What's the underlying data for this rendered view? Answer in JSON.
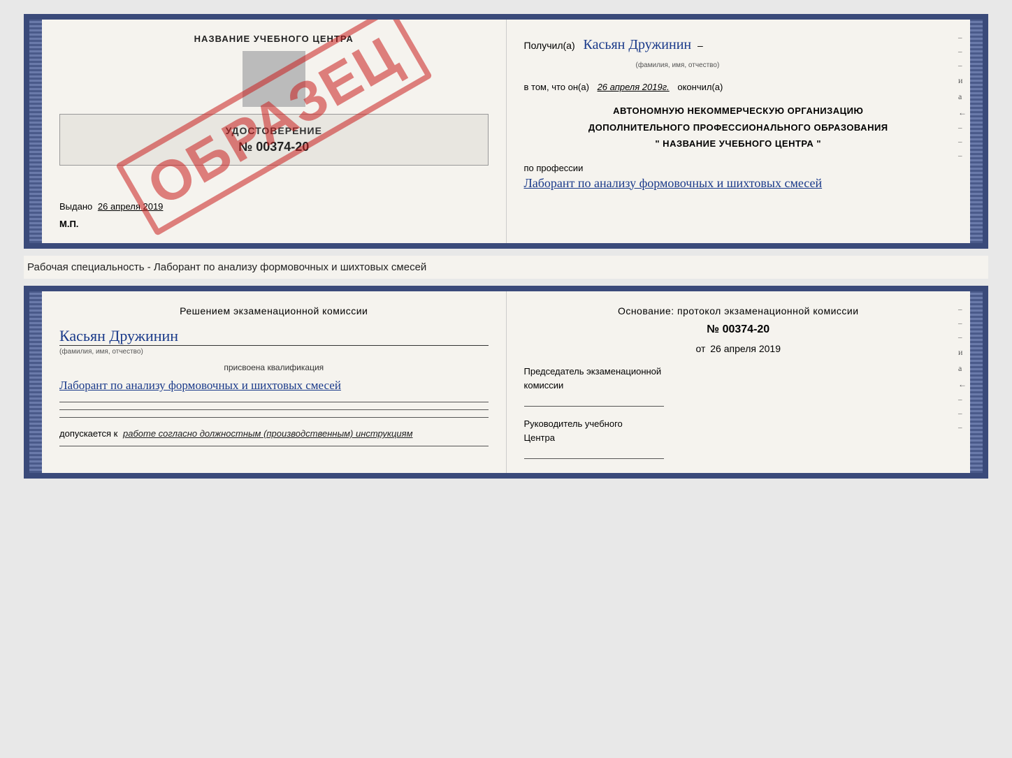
{
  "page": {
    "background": "#e8e8e8"
  },
  "top_section": {
    "left": {
      "title": "НАЗВАНИЕ УЧЕБНОГО ЦЕНТРА",
      "cert_title": "УДОСТОВЕРЕНИЕ",
      "cert_number": "№ 00374-20",
      "stamp_text": "ОБРАЗЕЦ",
      "issued_label": "Выдано",
      "issued_date": "26 апреля 2019",
      "mp_label": "М.П."
    },
    "right": {
      "received_prefix": "Получил(а)",
      "received_name": "Касьян Дружинин",
      "name_label": "(фамилия, имя, отчество)",
      "date_prefix": "в том, что он(а)",
      "date_value": "26 апреля 2019г.",
      "finished_label": "окончил(а)",
      "org_line1": "АВТОНОМНУЮ НЕКОММЕРЧЕСКУЮ ОРГАНИЗАЦИЮ",
      "org_line2": "ДОПОЛНИТЕЛЬНОГО ПРОФЕССИОНАЛЬНОГО ОБРАЗОВАНИЯ",
      "org_line3": "\" НАЗВАНИЕ УЧЕБНОГО ЦЕНТРА \"",
      "profession_label": "по профессии",
      "profession_text": "Лаборант по анализу формовочных и шихтовых смесей",
      "side_items": [
        "-",
        "-",
        "-",
        "и",
        "а",
        "←",
        "-",
        "-",
        "-"
      ]
    }
  },
  "middle": {
    "text": "Рабочая специальность - Лаборант по анализу формовочных и шихтовых смесей"
  },
  "bottom_section": {
    "left": {
      "commission_title": "Решением  экзаменационной  комиссии",
      "name": "Касьян  Дружинин",
      "name_label": "(фамилия, имя, отчество)",
      "qualification_label": "присвоена квалификация",
      "qualification_text": "Лаборант по анализу формовочных и шихтовых смесей",
      "admission_prefix": "допускается к",
      "admission_text": "работе согласно должностным (производственным) инструкциям"
    },
    "right": {
      "osnov_title": "Основание: протокол экзаменационной  комиссии",
      "protocol_number": "№  00374-20",
      "from_prefix": "от",
      "from_date": "26 апреля 2019",
      "chairman_label": "Председатель экзаменационной\nкомиссии",
      "head_label": "Руководитель учебного\nЦентра",
      "side_items": [
        "-",
        "-",
        "-",
        "и",
        "а",
        "←",
        "-",
        "-",
        "-"
      ]
    }
  }
}
